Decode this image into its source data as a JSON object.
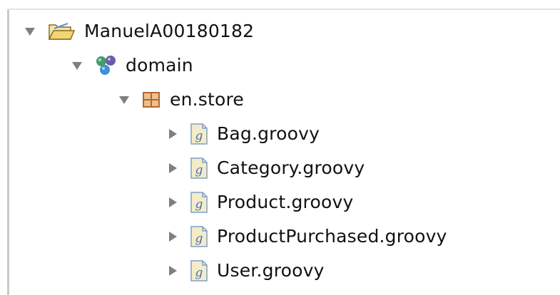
{
  "tree": {
    "project": {
      "label": "ManuelA00180182",
      "icon": "open-folder-icon",
      "expanded": true
    },
    "source_folder": {
      "label": "domain",
      "icon": "source-folder-icon",
      "expanded": true
    },
    "package": {
      "label": "en.store",
      "icon": "package-icon",
      "expanded": true
    },
    "files": [
      {
        "label": "Bag.groovy",
        "icon": "groovy-file-icon",
        "expanded": false
      },
      {
        "label": "Category.groovy",
        "icon": "groovy-file-icon",
        "expanded": false
      },
      {
        "label": "Product.groovy",
        "icon": "groovy-file-icon",
        "expanded": false
      },
      {
        "label": "ProductPurchased.groovy",
        "icon": "groovy-file-icon",
        "expanded": false
      },
      {
        "label": "User.groovy",
        "icon": "groovy-file-icon",
        "expanded": false
      }
    ]
  },
  "colors": {
    "twisty": "#7f7f7f",
    "folder_yellow": "#f2d676",
    "package_brown": "#b5652f",
    "groovy_file_outline": "#7f9ec6"
  }
}
